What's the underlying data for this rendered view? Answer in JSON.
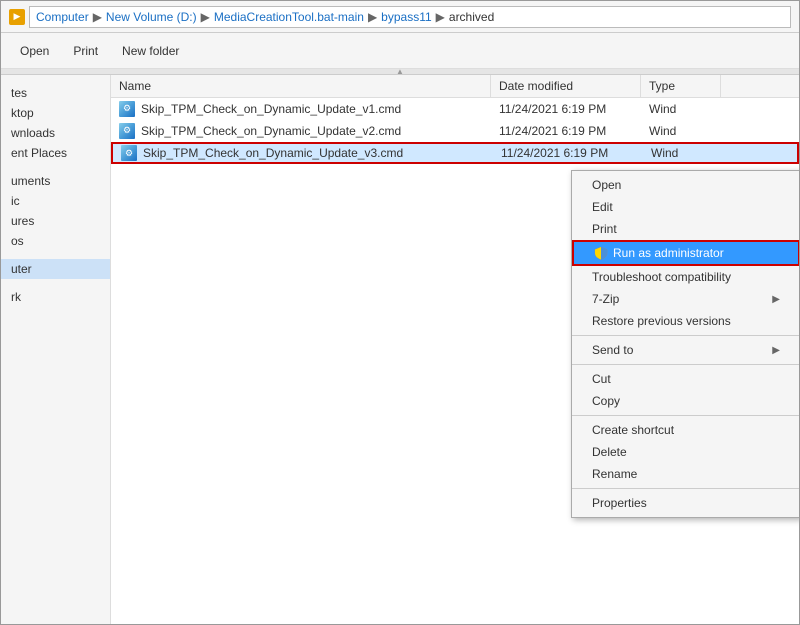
{
  "addressBar": {
    "icon": "📁",
    "breadcrumbs": [
      {
        "label": "Computer",
        "sep": "▶"
      },
      {
        "label": "New Volume (D:)",
        "sep": "▶"
      },
      {
        "label": "MediaCreationTool.bat-main",
        "sep": "▶"
      },
      {
        "label": "bypass11",
        "sep": "▶"
      },
      {
        "label": "archived",
        "sep": ""
      }
    ]
  },
  "toolbar": {
    "open_label": "Open",
    "print_label": "Print",
    "new_folder_label": "New folder"
  },
  "sidebar": {
    "items": [
      {
        "label": "tes",
        "id": "tes"
      },
      {
        "label": "ktop",
        "id": "ktop"
      },
      {
        "label": "wnloads",
        "id": "wnloads"
      },
      {
        "label": "ent Places",
        "id": "ent-places"
      },
      {
        "label": "uments",
        "id": "uments"
      },
      {
        "label": "ic",
        "id": "ic"
      },
      {
        "label": "ures",
        "id": "ures"
      },
      {
        "label": "os",
        "id": "os"
      },
      {
        "label": "uter",
        "id": "uter"
      },
      {
        "label": "rk",
        "id": "rk"
      }
    ]
  },
  "fileList": {
    "columns": [
      {
        "label": "Name",
        "id": "name"
      },
      {
        "label": "Date modified",
        "id": "date"
      },
      {
        "label": "Type",
        "id": "type"
      }
    ],
    "files": [
      {
        "name": "Skip_TPM_Check_on_Dynamic_Update_v1.cmd",
        "date": "11/24/2021 6:19 PM",
        "type": "Wind",
        "selected": false,
        "highlighted": false
      },
      {
        "name": "Skip_TPM_Check_on_Dynamic_Update_v2.cmd",
        "date": "11/24/2021 6:19 PM",
        "type": "Wind",
        "selected": false,
        "highlighted": false
      },
      {
        "name": "Skip_TPM_Check_on_Dynamic_Update_v3.cmd",
        "date": "11/24/2021 6:19 PM",
        "type": "Wind",
        "selected": true,
        "highlighted": true
      }
    ]
  },
  "contextMenu": {
    "items": [
      {
        "label": "Open",
        "id": "open",
        "separator_after": false,
        "highlighted": false,
        "has_arrow": false,
        "has_icon": false
      },
      {
        "label": "Edit",
        "id": "edit",
        "separator_after": false,
        "highlighted": false,
        "has_arrow": false,
        "has_icon": false
      },
      {
        "label": "Print",
        "id": "print",
        "separator_after": false,
        "highlighted": false,
        "has_arrow": false,
        "has_icon": false
      },
      {
        "label": "Run as administrator",
        "id": "run-as-admin",
        "separator_after": false,
        "highlighted": true,
        "has_arrow": false,
        "has_icon": true
      },
      {
        "label": "Troubleshoot compatibility",
        "id": "troubleshoot",
        "separator_after": false,
        "highlighted": false,
        "has_arrow": false,
        "has_icon": false
      },
      {
        "label": "7-Zip",
        "id": "7zip",
        "separator_after": false,
        "highlighted": false,
        "has_arrow": true,
        "has_icon": false
      },
      {
        "label": "Restore previous versions",
        "id": "restore",
        "separator_after": true,
        "highlighted": false,
        "has_arrow": false,
        "has_icon": false
      },
      {
        "label": "Send to",
        "id": "send-to",
        "separator_after": true,
        "highlighted": false,
        "has_arrow": true,
        "has_icon": false
      },
      {
        "label": "Cut",
        "id": "cut",
        "separator_after": false,
        "highlighted": false,
        "has_arrow": false,
        "has_icon": false
      },
      {
        "label": "Copy",
        "id": "copy",
        "separator_after": true,
        "highlighted": false,
        "has_arrow": false,
        "has_icon": false
      },
      {
        "label": "Create shortcut",
        "id": "create-shortcut",
        "separator_after": false,
        "highlighted": false,
        "has_arrow": false,
        "has_icon": false
      },
      {
        "label": "Delete",
        "id": "delete",
        "separator_after": false,
        "highlighted": false,
        "has_arrow": false,
        "has_icon": false
      },
      {
        "label": "Rename",
        "id": "rename",
        "separator_after": true,
        "highlighted": false,
        "has_arrow": false,
        "has_icon": false
      },
      {
        "label": "Properties",
        "id": "properties",
        "separator_after": false,
        "highlighted": false,
        "has_arrow": false,
        "has_icon": false
      }
    ]
  }
}
